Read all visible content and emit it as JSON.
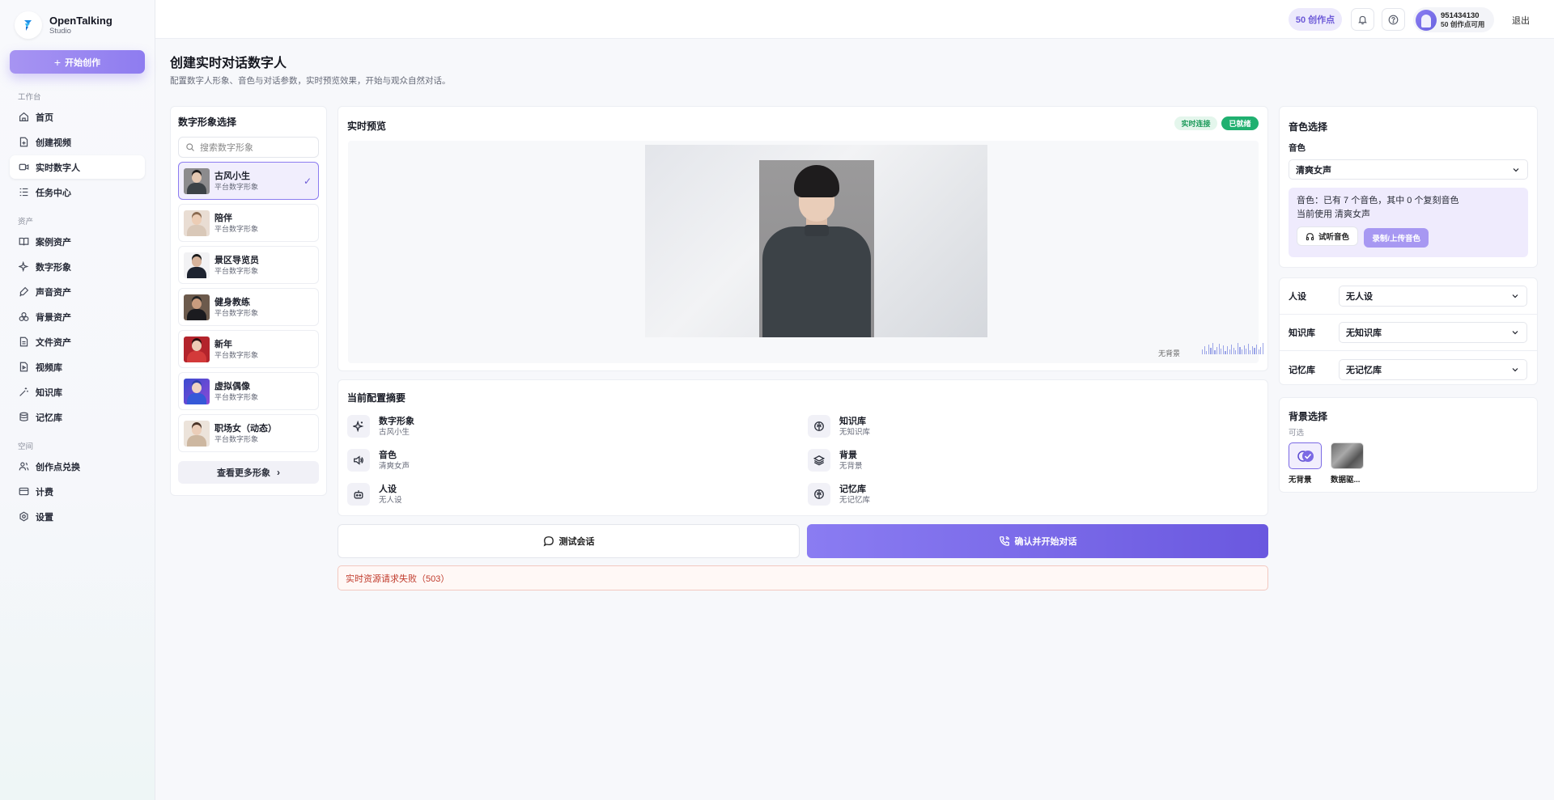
{
  "brand": {
    "name": "OpenTalking",
    "sub": "Studio"
  },
  "sidebar": {
    "start_label": "开始创作",
    "sections": {
      "workbench": "工作台",
      "assets": "资产",
      "space": "空间"
    },
    "items": [
      {
        "label": "首页",
        "icon": "home-icon"
      },
      {
        "label": "创建视频",
        "icon": "file-plus-icon"
      },
      {
        "label": "实时数字人",
        "icon": "video-camera-icon"
      },
      {
        "label": "任务中心",
        "icon": "list-icon"
      },
      {
        "label": "案例资产",
        "icon": "book-icon"
      },
      {
        "label": "数字形象",
        "icon": "sparkle-icon"
      },
      {
        "label": "声音资产",
        "icon": "mic-icon"
      },
      {
        "label": "背景资产",
        "icon": "layers-icon"
      },
      {
        "label": "文件资产",
        "icon": "file-icon"
      },
      {
        "label": "视频库",
        "icon": "video-file-icon"
      },
      {
        "label": "知识库",
        "icon": "wand-icon"
      },
      {
        "label": "记忆库",
        "icon": "database-icon"
      },
      {
        "label": "创作点兑换",
        "icon": "users-icon"
      },
      {
        "label": "计费",
        "icon": "card-icon"
      },
      {
        "label": "设置",
        "icon": "gear-icon"
      }
    ]
  },
  "topbar": {
    "credits": "50 创作点",
    "user_id": "951434130",
    "user_credit": "50 创作点可用",
    "logout": "退出"
  },
  "page": {
    "title": "创建实时对话数字人",
    "desc": "配置数字人形象、音色与对话参数，实时预览效果，开始与观众自然对话。"
  },
  "avatars": {
    "title": "数字形象选择",
    "search_placeholder": "搜索数字形象",
    "items": [
      {
        "name": "古风小生",
        "sub": "平台数字形象"
      },
      {
        "name": "陪伴",
        "sub": "平台数字形象"
      },
      {
        "name": "景区导览员",
        "sub": "平台数字形象"
      },
      {
        "name": "健身教练",
        "sub": "平台数字形象"
      },
      {
        "name": "新年",
        "sub": "平台数字形象"
      },
      {
        "name": "虚拟偶像",
        "sub": "平台数字形象"
      },
      {
        "name": "职场女（动态）",
        "sub": "平台数字形象"
      }
    ],
    "more": "查看更多形象"
  },
  "preview": {
    "title": "实时预览",
    "badge_live": "实时连接",
    "badge_ready": "已就绪",
    "bg_label": "无背景"
  },
  "summary": {
    "title": "当前配置摘要",
    "items": [
      {
        "label": "数字形象",
        "value": "古风小生"
      },
      {
        "label": "知识库",
        "value": "无知识库"
      },
      {
        "label": "音色",
        "value": "清爽女声"
      },
      {
        "label": "背景",
        "value": "无背景"
      },
      {
        "label": "人设",
        "value": "无人设"
      },
      {
        "label": "记忆库",
        "value": "无记忆库"
      }
    ]
  },
  "actions": {
    "test": "测试会话",
    "start": "确认并开始对话",
    "error": "实时资源请求失败（503）"
  },
  "voice": {
    "title": "音色选择",
    "label": "音色",
    "selected": "清爽女声",
    "info_line1": "音色：已有 7 个音色，其中 0 个复刻音色",
    "info_line2": "当前使用 清爽女声",
    "listen": "试听音色",
    "record": "录制/上传音色"
  },
  "settings": {
    "persona_label": "人设",
    "persona_value": "无人设",
    "kb_label": "知识库",
    "kb_value": "无知识库",
    "memory_label": "记忆库",
    "memory_value": "无记忆库"
  },
  "background": {
    "title": "背景选择",
    "optional": "可选",
    "options": [
      {
        "caption": "无背景"
      },
      {
        "caption": "数据驱..."
      }
    ]
  }
}
